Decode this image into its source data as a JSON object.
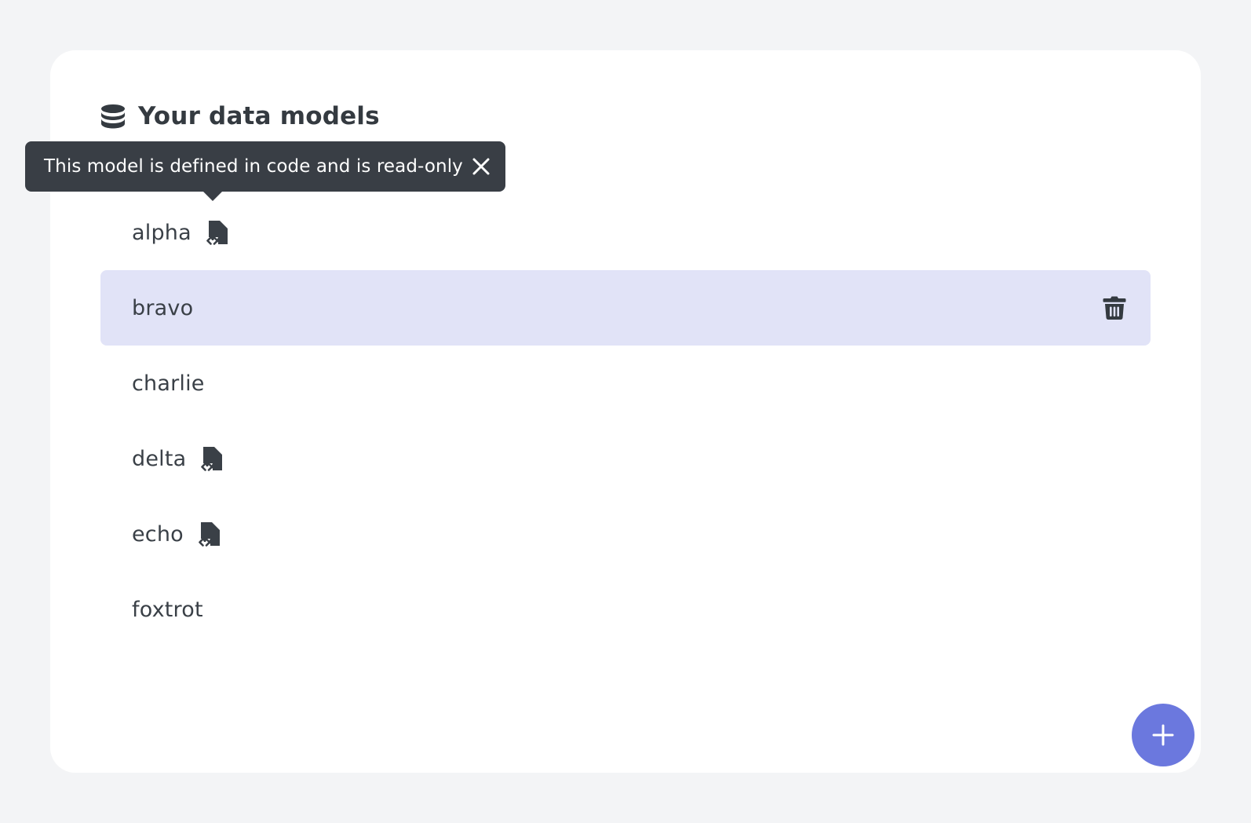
{
  "header": {
    "icon": "database-icon",
    "title": "Your data models"
  },
  "tooltip": {
    "text": "This model is defined in code and is read-only",
    "close_icon": "close-icon"
  },
  "models": [
    {
      "name": "alpha",
      "code_defined": true,
      "selected": false
    },
    {
      "name": "bravo",
      "code_defined": false,
      "selected": true
    },
    {
      "name": "charlie",
      "code_defined": false,
      "selected": false
    },
    {
      "name": "delta",
      "code_defined": true,
      "selected": false
    },
    {
      "name": "echo",
      "code_defined": true,
      "selected": false
    },
    {
      "name": "foxtrot",
      "code_defined": false,
      "selected": false
    }
  ],
  "actions": {
    "delete_icon": "trash-icon",
    "add_icon": "plus-icon"
  },
  "colors": {
    "page_background": "#f3f4f6",
    "card_background": "#ffffff",
    "text": "#343a40",
    "tooltip_background": "#393e45",
    "selected_row": "#e1e3f7",
    "accent": "#6b78de"
  }
}
